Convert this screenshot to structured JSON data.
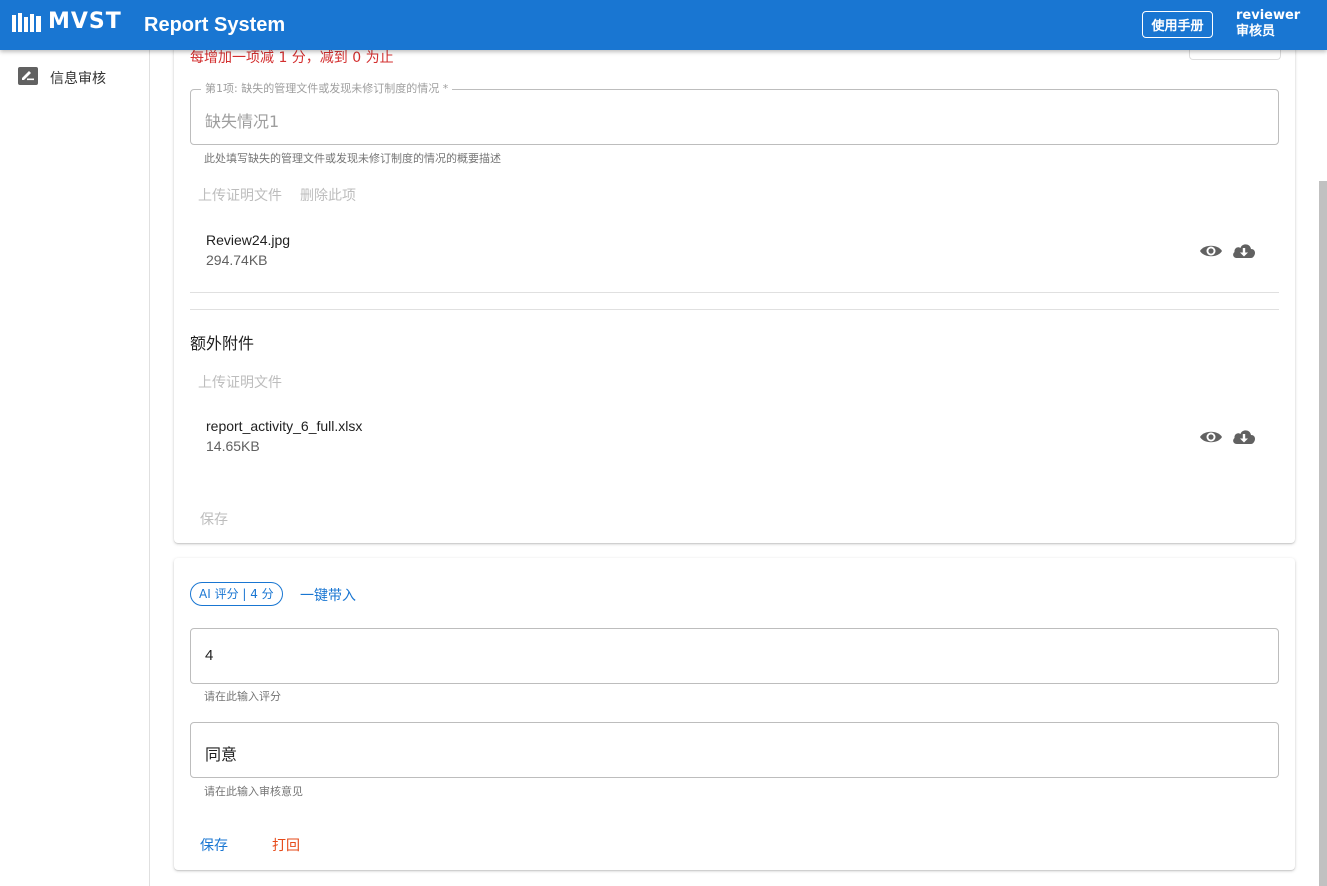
{
  "header": {
    "logo_text": "MVST",
    "title": "Report System",
    "manual_label": "使用手册",
    "user_name": "reviewer",
    "user_role": "审核员"
  },
  "sidebar": {
    "items": [
      {
        "label": "信息审核",
        "icon": "edit-note-icon"
      }
    ]
  },
  "review_section": {
    "rule_text": "每增加一项减 1 分，减到 0 为止",
    "item1": {
      "legend": "第1项: 缺失的管理文件或发现未修订制度的情况 *",
      "value": "缺失情况1",
      "helper": "此处填写缺失的管理文件或发现未修订制度的情况的概要描述",
      "upload_label": "上传证明文件",
      "delete_label": "删除此项",
      "file": {
        "name": "Review24.jpg",
        "size": "294.74KB"
      }
    },
    "extra": {
      "title": "额外附件",
      "upload_label": "上传证明文件",
      "file": {
        "name": "report_activity_6_full.xlsx",
        "size": "14.65KB"
      }
    },
    "save_label": "保存"
  },
  "score_section": {
    "ai_chip": "AI 评分 | 4 分",
    "apply_label": "一键带入",
    "score": {
      "value": "4",
      "helper": "请在此输入评分"
    },
    "comment": {
      "value": "同意",
      "helper": "请在此输入审核意见"
    },
    "save_label": "保存",
    "reject_label": "打回"
  },
  "colors": {
    "primary": "#1976d2",
    "danger": "#e64a19",
    "rule_red": "#d32f2f"
  }
}
